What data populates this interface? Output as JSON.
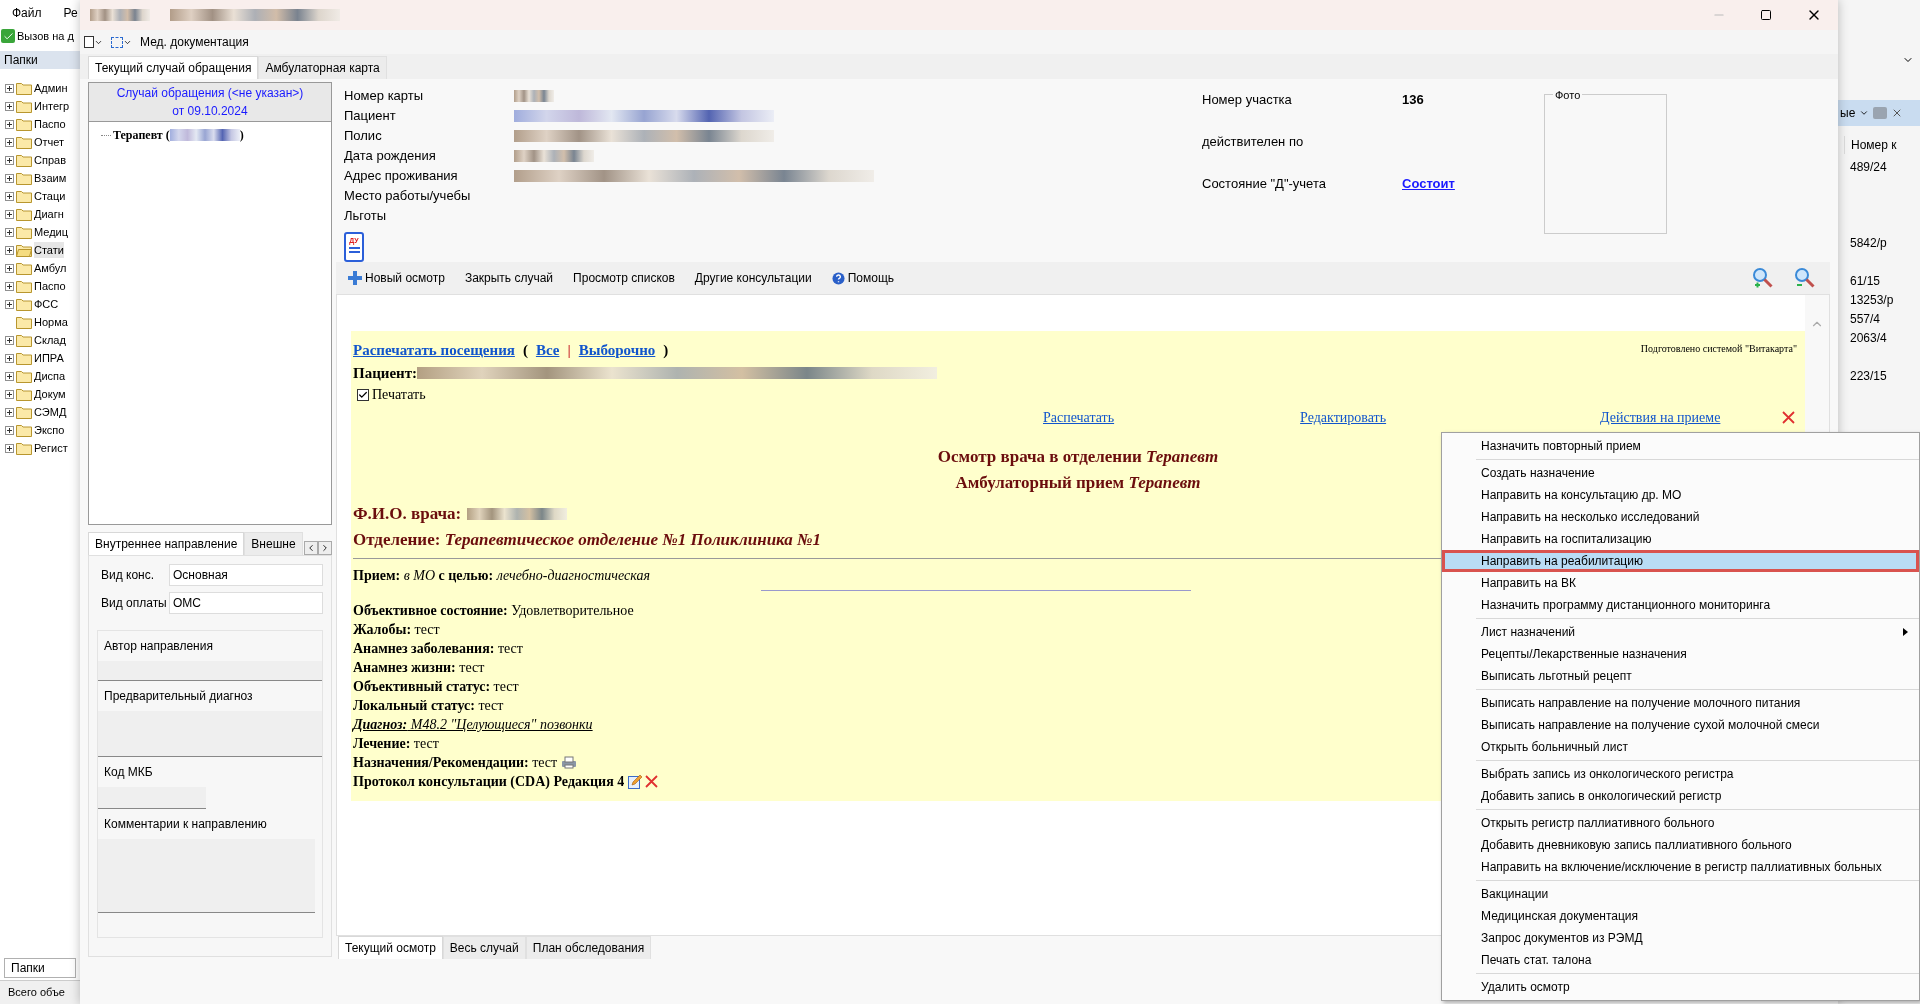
{
  "background_app": {
    "menu": [
      "Файл",
      "Ре"
    ],
    "toolbar_button": "Вызов на д",
    "folders_header": "Папки",
    "folders": [
      {
        "label": "Админ",
        "expandable": true,
        "selected": false
      },
      {
        "label": "Интегр",
        "expandable": true,
        "selected": false
      },
      {
        "label": "Паспо",
        "expandable": true,
        "selected": false
      },
      {
        "label": "Отчет",
        "expandable": true,
        "selected": false
      },
      {
        "label": "Справ",
        "expandable": true,
        "selected": false
      },
      {
        "label": "Взаим",
        "expandable": true,
        "selected": false
      },
      {
        "label": "Стаци",
        "expandable": true,
        "selected": false
      },
      {
        "label": "Диагн",
        "expandable": true,
        "selected": false
      },
      {
        "label": "Медиц",
        "expandable": true,
        "selected": false
      },
      {
        "label": "Стати",
        "expandable": true,
        "selected": true
      },
      {
        "label": "Амбул",
        "expandable": true,
        "selected": false
      },
      {
        "label": "Паспо",
        "expandable": true,
        "selected": false
      },
      {
        "label": "ФСС",
        "expandable": true,
        "selected": false
      },
      {
        "label": "Норма",
        "expandable": false,
        "selected": false
      },
      {
        "label": "Склад",
        "expandable": true,
        "selected": false
      },
      {
        "label": "ИПРА",
        "expandable": true,
        "selected": false
      },
      {
        "label": "Диспа",
        "expandable": true,
        "selected": false
      },
      {
        "label": "Докум",
        "expandable": true,
        "selected": false
      },
      {
        "label": "СЭМД",
        "expandable": true,
        "selected": false
      },
      {
        "label": "Экспо",
        "expandable": true,
        "selected": false
      },
      {
        "label": "Регист",
        "expandable": true,
        "selected": false
      }
    ],
    "bottom_tab": "Папки",
    "status": "Всего объе",
    "right_panel": {
      "filter": "ые",
      "column": "Номер к",
      "rows": [
        "489/24",
        "",
        "",
        "",
        "5842/р",
        "",
        "61/15",
        "13253/р",
        "557/4",
        "2063/4",
        "",
        "223/15"
      ]
    }
  },
  "window": {
    "toolbar_label": "Мед. документация",
    "tabs": [
      {
        "label": "Текущий случай обращения",
        "selected": true
      },
      {
        "label": "Амбулаторная карта",
        "selected": false
      }
    ],
    "case": {
      "title": "Случай обращения (<не указан>)",
      "date": "от 09.10.2024",
      "tree_item_start": "Терапевт (",
      "tree_item_end": ")"
    },
    "referral_tabs": [
      {
        "label": "Внутреннее направление",
        "selected": true
      },
      {
        "label": "Внешне",
        "selected": false
      }
    ],
    "referral_fields": [
      {
        "label": "Вид конс.",
        "value": "Основная"
      },
      {
        "label": "Вид оплаты",
        "value": "ОМС"
      }
    ],
    "referral_groups": [
      {
        "label": "Автор направления",
        "kind": "wide"
      },
      {
        "label": "Предварительный диагноз",
        "kind": "tall"
      },
      {
        "label": "Код МКБ",
        "kind": "short"
      },
      {
        "label": "Комментарии к направлению",
        "kind": "area"
      }
    ],
    "patient_fields": [
      {
        "label": "Номер карты",
        "redacted": true
      },
      {
        "label": "Пациент",
        "redacted": true
      },
      {
        "label": "Полис",
        "redacted": true
      },
      {
        "label": "Дата рождения",
        "redacted": true
      },
      {
        "label": "Адрес проживания",
        "redacted": true
      },
      {
        "label": "Место работы/учебы",
        "redacted": false
      },
      {
        "label": "Льготы",
        "redacted": false
      }
    ],
    "district": {
      "label": "Номер участка",
      "value": "136"
    },
    "valid_until": {
      "label": "действителен по"
    },
    "d_status": {
      "label": "Состояние \"Д\"-учета",
      "value": "Состоит"
    },
    "photo": {
      "label": "Фото"
    },
    "du_badge": "ДУ",
    "toolbar": [
      {
        "label": "Новый осмотр",
        "kind": "add"
      },
      {
        "label": "Закрыть случай",
        "kind": "plain"
      },
      {
        "label": "Просмотр списков",
        "kind": "plain"
      },
      {
        "label": "Другие консультации",
        "kind": "plain"
      },
      {
        "label": "Помощь",
        "kind": "help"
      }
    ],
    "document": {
      "print_visits": "Распечатать посещения",
      "paren_open": "(",
      "all": "Все",
      "bar": "|",
      "selective": "Выборочно",
      "paren_close": ")",
      "prepared_by": "Подготовлено системой \"Витакарта\"",
      "patient_label": "Пациент:",
      "print_checkbox": {
        "label": "Печатать",
        "checked": true
      },
      "actions": [
        "Распечатать",
        "Редактировать",
        "Действия на приеме"
      ],
      "headings": [
        "Осмотр врача в отделении *Терапевт*",
        "Амбулаторный прием *Терапевт*"
      ],
      "doctor_label": "Ф.И.О. врача:",
      "department": "Отделение: *Терапевтическое отделение №1 Поликлиника №1*",
      "visit": "**Прием:** *в МО* **с целью:** *лечебно-диагностическая*",
      "lines": [
        {
          "text": "**Объективное состояние:** Удовлетворительное",
          "kind": "field"
        },
        {
          "text": "**Жалобы:** тест",
          "kind": "field"
        },
        {
          "text": "**Анамнез заболевания:** тест",
          "kind": "field"
        },
        {
          "text": "**Анамнез жизни:** тест",
          "kind": "field"
        },
        {
          "text": "**Объективный статус:** тест",
          "kind": "field"
        },
        {
          "text": "**Локальный статус:** тест",
          "kind": "field"
        },
        {
          "text": "**Диагноз:** М48.2 \"Целующиеся\" позвонки",
          "kind": "diagnosis"
        },
        {
          "text": "**Лечение:** тест",
          "kind": "field"
        },
        {
          "text": "**Назначения/Рекомендации:** тест",
          "kind": "print"
        },
        {
          "text": "**Протокол консультации (CDA) Редакция 4**",
          "kind": "protocol"
        }
      ]
    },
    "bottom_tabs": [
      {
        "label": "Текущий осмотр",
        "selected": true
      },
      {
        "label": "Весь случай",
        "selected": false
      },
      {
        "label": "План обследования",
        "selected": false
      }
    ]
  },
  "context_menu": [
    [
      {
        "label": "Назначить повторный прием",
        "selected": false,
        "submenu": false
      }
    ],
    [
      {
        "label": "Создать назначение",
        "selected": false,
        "submenu": false
      },
      {
        "label": "Направить на консультацию др. МО",
        "selected": false,
        "submenu": false
      },
      {
        "label": "Направить на несколько исследований",
        "selected": false,
        "submenu": false
      },
      {
        "label": "Направить на госпитализацию",
        "selected": false,
        "submenu": false
      },
      {
        "label": "Направить на реабилитацию",
        "selected": true,
        "submenu": false
      },
      {
        "label": "Направить на ВК",
        "selected": false,
        "submenu": false
      },
      {
        "label": "Назначить программу дистанционного мониторинга",
        "selected": false,
        "submenu": false
      }
    ],
    [
      {
        "label": "Лист назначений",
        "selected": false,
        "submenu": true
      },
      {
        "label": "Рецепты/Лекарственные назначения",
        "selected": false,
        "submenu": false
      },
      {
        "label": "Выписать льготный рецепт",
        "selected": false,
        "submenu": false
      }
    ],
    [
      {
        "label": "Выписать направление на получение молочного питания",
        "selected": false,
        "submenu": false
      },
      {
        "label": "Выписать направление на получение сухой молочной смеси",
        "selected": false,
        "submenu": false
      },
      {
        "label": "Открыть больничный лист",
        "selected": false,
        "submenu": false
      }
    ],
    [
      {
        "label": "Выбрать запись из онкологического регистра",
        "selected": false,
        "submenu": false
      },
      {
        "label": "Добавить запись в онкологический регистр",
        "selected": false,
        "submenu": false
      }
    ],
    [
      {
        "label": "Открыть регистр паллиативного больного",
        "selected": false,
        "submenu": false
      },
      {
        "label": "Добавить дневниковую запись паллиативного больного",
        "selected": false,
        "submenu": false
      },
      {
        "label": "Направить на включение/исключение в регистр паллиативных больных",
        "selected": false,
        "submenu": false
      }
    ],
    [
      {
        "label": "Вакцинации",
        "selected": false,
        "submenu": false
      },
      {
        "label": "Медицинская документация",
        "selected": false,
        "submenu": false
      },
      {
        "label": "Запрос документов из РЭМД",
        "selected": false,
        "submenu": false
      },
      {
        "label": "Печать стат. талона",
        "selected": false,
        "submenu": false
      }
    ],
    [
      {
        "label": "Удалить осмотр",
        "selected": false,
        "submenu": false
      }
    ]
  ]
}
